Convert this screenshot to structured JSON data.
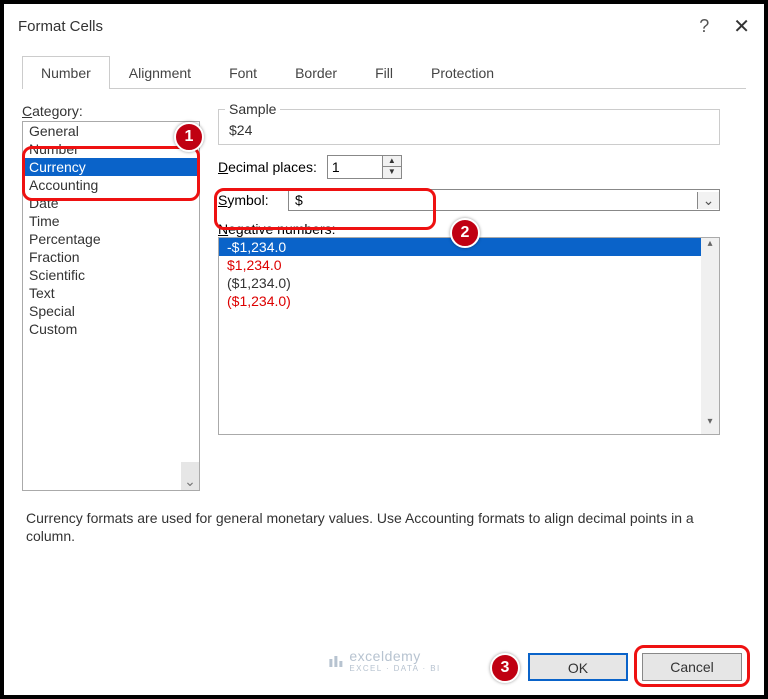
{
  "window": {
    "title": "Format Cells",
    "help": "?",
    "close": "✕"
  },
  "tabs": [
    "Number",
    "Alignment",
    "Font",
    "Border",
    "Fill",
    "Protection"
  ],
  "activeTab": 0,
  "category": {
    "label": "Category:",
    "items": [
      "General",
      "Number",
      "Currency",
      "Accounting",
      "Date",
      "Time",
      "Percentage",
      "Fraction",
      "Scientific",
      "Text",
      "Special",
      "Custom"
    ],
    "selectedIndex": 2
  },
  "sample": {
    "label": "Sample",
    "value": "$24"
  },
  "decimal": {
    "label": "Decimal places:",
    "value": "1"
  },
  "symbol": {
    "label": "Symbol:",
    "value": "$"
  },
  "negative": {
    "label": "Negative numbers:",
    "items": [
      {
        "text": "-$1,234.0",
        "style": "sel"
      },
      {
        "text": "$1,234.0",
        "style": "red"
      },
      {
        "text": "($1,234.0)",
        "style": "blk"
      },
      {
        "text": "($1,234.0)",
        "style": "red"
      }
    ]
  },
  "description": "Currency formats are used for general monetary values.  Use Accounting formats to align decimal points in a column.",
  "buttons": {
    "ok": "OK",
    "cancel": "Cancel"
  },
  "badges": {
    "b1": "1",
    "b2": "2",
    "b3": "3"
  },
  "watermark": {
    "brand": "exceldemy",
    "tag": "EXCEL · DATA · BI"
  }
}
